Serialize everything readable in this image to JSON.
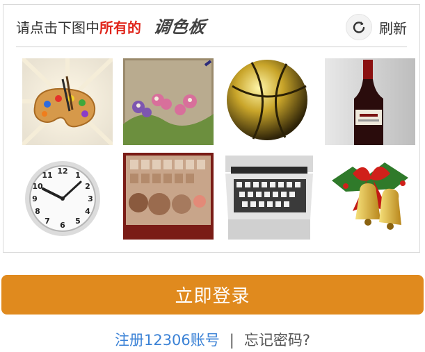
{
  "captcha": {
    "prompt_prefix": "请点击下图中",
    "prompt_highlight": "所有的",
    "prompt_keyword": "调色板",
    "refresh_label": "刷新",
    "tiles": [
      {
        "subject": "painter-palette"
      },
      {
        "subject": "flower-embroidery"
      },
      {
        "subject": "golden-ball"
      },
      {
        "subject": "wine-bottle"
      },
      {
        "subject": "wall-clock"
      },
      {
        "subject": "paint-box"
      },
      {
        "subject": "typewriter"
      },
      {
        "subject": "christmas-bells"
      }
    ]
  },
  "login_button": "立即登录",
  "links": {
    "register": "注册12306账号",
    "separator": "|",
    "forgot": "忘记密码?"
  },
  "colors": {
    "accent": "#e08a1e",
    "highlight": "#e0251b",
    "link": "#3b82d6"
  }
}
